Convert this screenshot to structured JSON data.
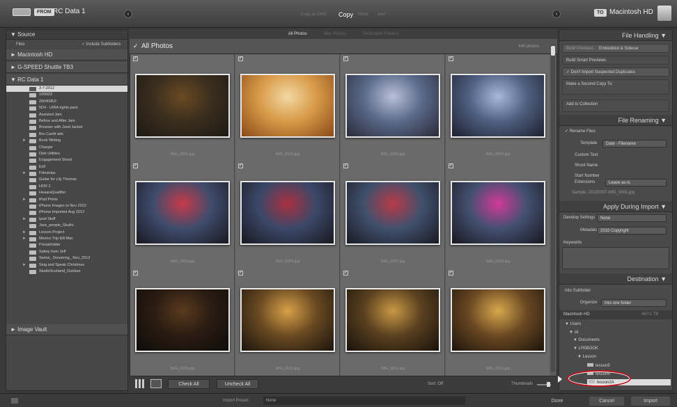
{
  "topbar": {
    "from_label": "FROM",
    "source_name": "RC Data 1",
    "modes": [
      "Copy as DNG",
      "Copy",
      "Move",
      "Add"
    ],
    "active_mode": "Copy",
    "to_label": "TO",
    "dest_name": "Macintosh HD"
  },
  "source": {
    "title": "Source",
    "files_label": "Files",
    "include_subfolders": "Include Subfolders",
    "volumes": [
      "Macintosh HD",
      "G-SPEED Shuttle TB3",
      "RC Data 1"
    ],
    "folders": [
      {
        "name": "3-7-2012",
        "sel": true,
        "arrow": false
      },
      {
        "name": "1000D2",
        "sel": false,
        "arrow": false
      },
      {
        "name": "2004D8UI",
        "sel": false,
        "arrow": false
      },
      {
        "name": "5D4 - UIRA rights pack",
        "sel": false,
        "arrow": false
      },
      {
        "name": "Assisted Jam",
        "sel": false,
        "arrow": false
      },
      {
        "name": "Before and After Jam",
        "sel": false,
        "arrow": false
      },
      {
        "name": "Browser with Joed Jacket",
        "sel": false,
        "arrow": false
      },
      {
        "name": "Bro Cashf ads",
        "sel": false,
        "arrow": false
      },
      {
        "name": "Book Writing",
        "sel": false,
        "arrow": true
      },
      {
        "name": "Charger",
        "sel": false,
        "arrow": false
      },
      {
        "name": "Disk Utilities",
        "sel": false,
        "arrow": false
      },
      {
        "name": "Engagement Shoot",
        "sel": false,
        "arrow": false
      },
      {
        "name": "Exif",
        "sel": false,
        "arrow": false
      },
      {
        "name": "Filmstrips",
        "sel": false,
        "arrow": true
      },
      {
        "name": "Guitar for Lily Thomas",
        "sel": false,
        "arrow": false
      },
      {
        "name": "HDR 2",
        "sel": false,
        "arrow": false
      },
      {
        "name": "HeaaraQualifier",
        "sel": false,
        "arrow": false
      },
      {
        "name": "iPad Prints",
        "sel": false,
        "arrow": true
      },
      {
        "name": "iPhone Images to Nov 2012",
        "sel": false,
        "arrow": false
      },
      {
        "name": "iPhone Imported Aug 2012",
        "sel": false,
        "arrow": false
      },
      {
        "name": "Ipod Stuff",
        "sel": false,
        "arrow": true
      },
      {
        "name": "Jazz_people_Studio",
        "sel": false,
        "arrow": false
      },
      {
        "name": "Lesson Project",
        "sel": false,
        "arrow": true
      },
      {
        "name": "Mexico Trip Elli Mac",
        "sel": false,
        "arrow": true
      },
      {
        "name": "Privatefolder",
        "sel": false,
        "arrow": false
      },
      {
        "name": "Safety from Jeff",
        "sel": false,
        "arrow": false
      },
      {
        "name": "Samsi_ Dreaming_ Nov_2012",
        "sel": false,
        "arrow": false
      },
      {
        "name": "Sing and Speak Christmas",
        "sel": false,
        "arrow": true
      },
      {
        "name": "StudioScotland_Outdoor",
        "sel": false,
        "arrow": false
      }
    ],
    "image_vault": "Image Vault"
  },
  "grid": {
    "filters": [
      "All Photos",
      "New Photos",
      "Destination Folders"
    ],
    "title": "All Photos",
    "sort_label": "640 photos",
    "photos": [
      {
        "name": "IMG_0001.jpg",
        "colors": [
          "#1e1a14",
          "#3a2e1e",
          "#6b4a22"
        ]
      },
      {
        "name": "IMG_0002.jpg",
        "colors": [
          "#8a4a18",
          "#d89a48",
          "#f2d8a2"
        ]
      },
      {
        "name": "IMG_0003.jpg",
        "colors": [
          "#2a2a38",
          "#5a6a8a",
          "#b8c0d8"
        ]
      },
      {
        "name": "IMG_0004.jpg",
        "colors": [
          "#1c2030",
          "#506080",
          "#a8b8d8"
        ]
      },
      {
        "name": "IMG_0005.jpg",
        "colors": [
          "#1a1820",
          "#3e4c6c",
          "#c83a4a"
        ]
      },
      {
        "name": "IMG_0006.jpg",
        "colors": [
          "#1a1820",
          "#3a4868",
          "#a83040"
        ]
      },
      {
        "name": "IMG_0007.jpg",
        "colors": [
          "#1a1a24",
          "#40506c",
          "#b83a48"
        ]
      },
      {
        "name": "IMG_0008.jpg",
        "colors": [
          "#1a1820",
          "#425070",
          "#d03a9a"
        ]
      },
      {
        "name": "IMG_0009.jpg",
        "colors": [
          "#0e0c0a",
          "#2a1c12",
          "#5a3a1e"
        ]
      },
      {
        "name": "IMG_0010.jpg",
        "colors": [
          "#1a140c",
          "#6a4a22",
          "#d8a048"
        ]
      },
      {
        "name": "IMG_0011.jpg",
        "colors": [
          "#18120a",
          "#5a4020",
          "#c89844"
        ]
      },
      {
        "name": "IMG_0012.jpg",
        "colors": [
          "#1c140c",
          "#6a4822",
          "#d8a84e"
        ]
      }
    ],
    "check_all": "Check All",
    "uncheck_all": "Uncheck All",
    "sort_name": "Sort: Off",
    "thumbnails": "Thumbnails"
  },
  "right": {
    "file_handling": "File Handling",
    "build_previews": "Build Previews",
    "build_previews_val": "Embedded & Sidecar",
    "smart_previews": "Build Smart Previews",
    "dont_import_dupes": "Don't Import Suspected Duplicates",
    "second_copy": "Make a Second Copy To:",
    "add_to_collection": "Add to Collection",
    "file_renaming": "File Renaming",
    "rename_files": "Rename Files",
    "template_label": "Template",
    "template_val": "Date - Filename",
    "custom_text": "Custom Text",
    "shoot_name": "Shoot Name",
    "start_number": "Start Number",
    "extensions": "Extensions",
    "extensions_val": "Leave as-is",
    "sample": "Sample: 20120307-IMG_0001.jpg",
    "apply_during_import": "Apply During Import",
    "develop_settings": "Develop Settings",
    "develop_val": "None",
    "metadata": "Metadata",
    "metadata_val": "2015 Copyright",
    "keywords": "Keywords",
    "destination": "Destination",
    "into_subfolder": "Into Subfolder",
    "organize": "Organize",
    "organize_val": "Into one folder",
    "dest_volume": "Macintosh HD",
    "dest_volume_size": "467/1 TB",
    "tree": [
      "Users",
      "sk",
      "Documents",
      "LR5BOOK",
      "Lesson",
      "lesson5",
      "lesson6",
      "lesson2A"
    ]
  },
  "bottom": {
    "done": "Done",
    "preset_label": "Import Preset:",
    "preset_val": "None",
    "cancel": "Cancel",
    "import": "Import"
  }
}
